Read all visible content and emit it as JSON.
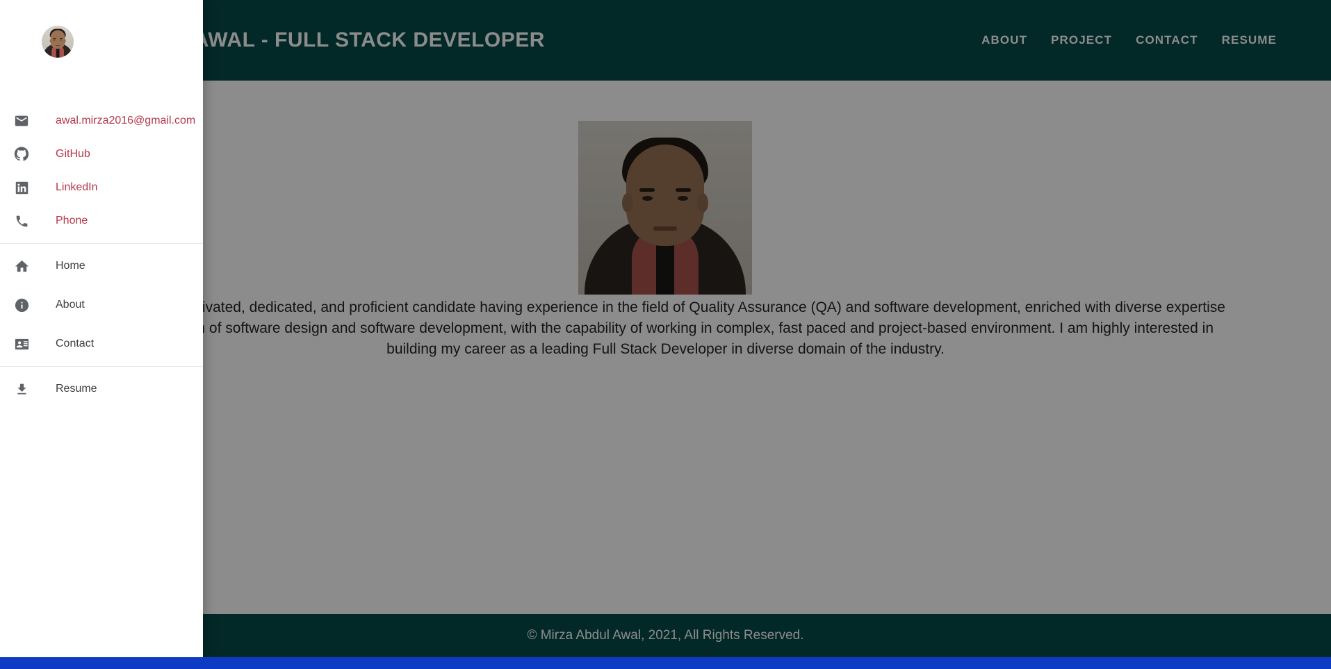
{
  "header": {
    "title": "MIRZA ABDUL AWAL - FULL STACK DEVELOPER",
    "background_color": "#044a47",
    "nav": [
      {
        "label": "ABOUT",
        "name": "nav-link-about"
      },
      {
        "label": "PROJECT",
        "name": "nav-link-project"
      },
      {
        "label": "CONTACT",
        "name": "nav-link-contact"
      },
      {
        "label": "RESUME",
        "name": "nav-link-resume"
      }
    ]
  },
  "main": {
    "profile_photo_alt": "Mirza Abdul Awal portrait photo",
    "intro_paragraph": "I am a self-motivated, dedicated, and proficient candidate having experience in the field of Quality Assurance (QA) and software development, enriched with diverse expertise in the domain of software design and software development, with the capability of working in complex, fast paced and project-based environment. I am highly interested in building my career as a leading Full Stack Developer in diverse domain of the industry."
  },
  "footer": {
    "copyright": "© Mirza Abdul Awal, 2021, All Rights Reserved."
  },
  "drawer": {
    "avatar_alt": "Mirza Abdul Awal avatar",
    "link_color": "#b5374a",
    "nav_color": "#3c4043",
    "icon_color": "#5f6368",
    "contact_links": [
      {
        "label": "awal.mirza2016@gmail.com",
        "icon": "email-icon",
        "name": "drawer-item-email"
      },
      {
        "label": "GitHub",
        "icon": "github-icon",
        "name": "drawer-item-github"
      },
      {
        "label": "LinkedIn",
        "icon": "linkedin-icon",
        "name": "drawer-item-linkedin"
      },
      {
        "label": "Phone",
        "icon": "phone-icon",
        "name": "drawer-item-phone"
      }
    ],
    "nav_items": [
      {
        "label": "Home",
        "icon": "home-icon",
        "name": "drawer-item-home"
      },
      {
        "label": "About",
        "icon": "info-icon",
        "name": "drawer-item-about"
      },
      {
        "label": "Contact",
        "icon": "contact-card-icon",
        "name": "drawer-item-contact"
      }
    ],
    "download_items": [
      {
        "label": "Resume",
        "icon": "download-icon",
        "name": "drawer-item-resume"
      }
    ]
  },
  "browser": {
    "bottom_bar_color": "#0d3bc4"
  }
}
